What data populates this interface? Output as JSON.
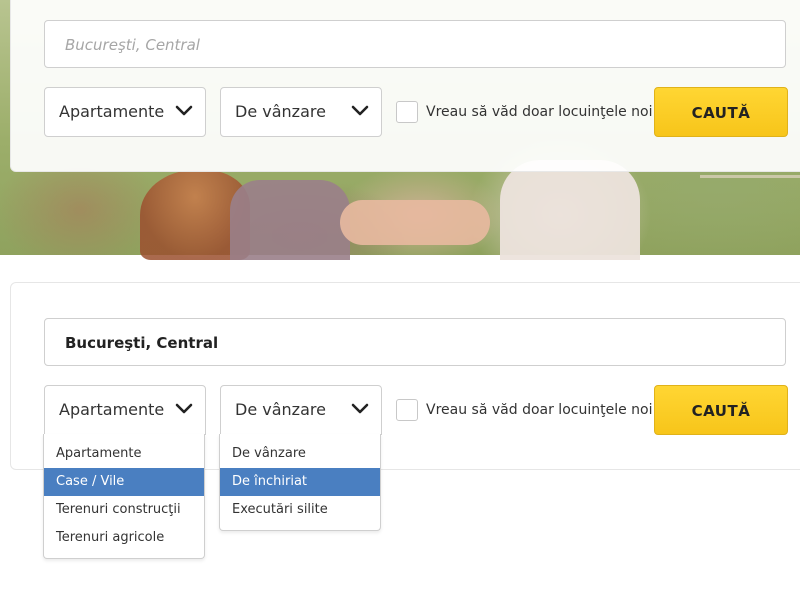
{
  "top_form": {
    "location": {
      "placeholder": "Bucureşti, Central",
      "value": ""
    },
    "property_type": {
      "selected": "Apartamente"
    },
    "transaction_type": {
      "selected": "De vânzare"
    },
    "new_only": {
      "label": "Vreau să văd doar locuinţele noi",
      "checked": false
    },
    "search_button": "CAUTĂ"
  },
  "bottom_form": {
    "location": {
      "value": "Bucureşti, Central"
    },
    "property_type": {
      "selected": "Apartamente",
      "options": [
        "Apartamente",
        "Case / Vile",
        "Terenuri construcţii",
        "Terenuri agricole"
      ],
      "highlighted_index": 1
    },
    "transaction_type": {
      "selected": "De vânzare",
      "options": [
        "De vânzare",
        "De închiriat",
        "Executări silite"
      ],
      "highlighted_index": 1
    },
    "new_only": {
      "label": "Vreau să văd doar locuinţele noi",
      "checked": false
    },
    "search_button": "CAUTĂ"
  },
  "colors": {
    "accent_yellow": "#f7c51a",
    "highlight_blue": "#4a7fc1"
  },
  "icons": {
    "dropdown": "chevron-down-icon"
  }
}
